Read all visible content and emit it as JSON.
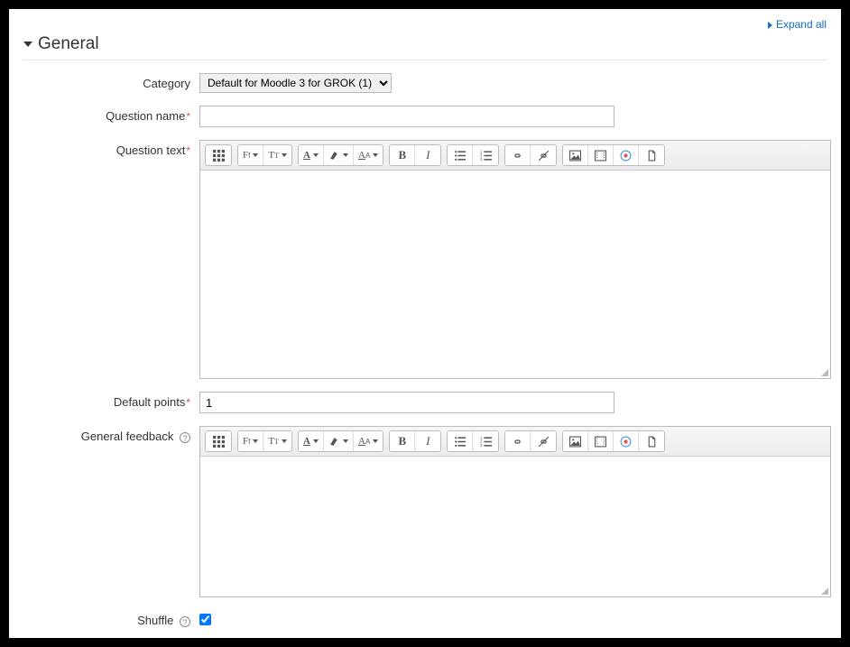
{
  "expand_all_label": "Expand all",
  "section_title": "General",
  "labels": {
    "category": "Category",
    "question_name": "Question name",
    "question_text": "Question text",
    "default_points": "Default points",
    "general_feedback": "General feedback",
    "shuffle": "Shuffle"
  },
  "category_selected": "Default for Moodle 3 for GROK (1)",
  "question_name_value": "",
  "default_points_value": "1",
  "shuffle_checked": true,
  "toolbar": {
    "toggle": "toggle-toolbar",
    "font_family": "Ff",
    "font_size": "T",
    "font_color": "A",
    "highlight": "hl",
    "clear": "A",
    "bold": "B",
    "italic": "I",
    "ul": "ul",
    "ol": "ol",
    "link": "link",
    "unlink": "unlink",
    "image": "img",
    "media": "media",
    "record": "rec",
    "files": "files"
  }
}
